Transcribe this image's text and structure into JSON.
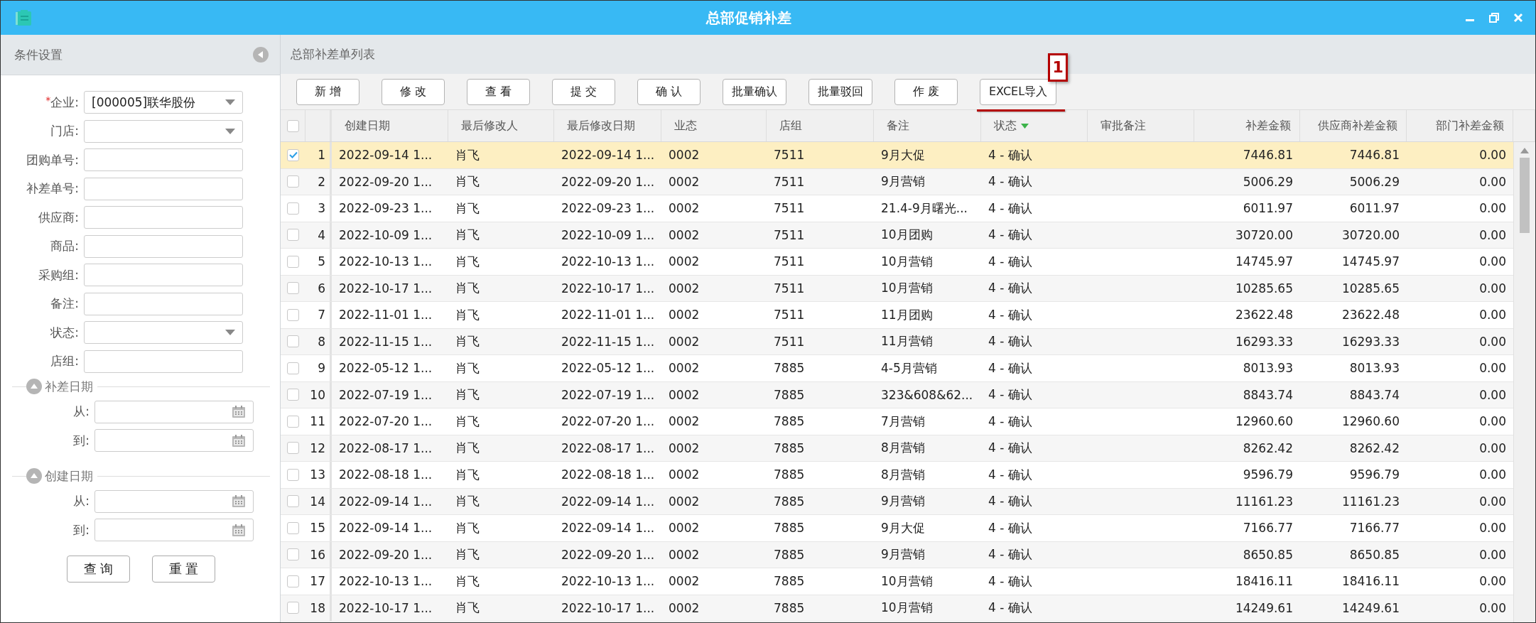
{
  "window": {
    "title": "总部促销补差"
  },
  "filter_panel": {
    "title": "条件设置",
    "fields": [
      {
        "label": "企业:",
        "marker": "*",
        "kind": "select",
        "value": "[000005]联华股份"
      },
      {
        "label": "门店:",
        "kind": "select"
      },
      {
        "label": "团购单号:",
        "kind": "text"
      },
      {
        "label": "补差单号:",
        "kind": "text"
      },
      {
        "label": "供应商:",
        "kind": "text"
      },
      {
        "label": "商品:",
        "kind": "text"
      },
      {
        "label": "采购组:",
        "kind": "text"
      },
      {
        "label": "备注:",
        "kind": "text"
      },
      {
        "label": "状态:",
        "kind": "select"
      },
      {
        "label": "店组:",
        "kind": "text"
      }
    ],
    "sections": [
      {
        "title": "补差日期",
        "expanded": true,
        "fields": [
          {
            "label": "从:"
          },
          {
            "label": "到:"
          }
        ]
      },
      {
        "title": "创建日期",
        "expanded": true,
        "fields": [
          {
            "label": "从:"
          },
          {
            "label": "到:"
          }
        ]
      }
    ],
    "buttons": [
      "查 询",
      "重 置"
    ]
  },
  "list_panel": {
    "title": "总部补差单列表",
    "toolbar": [
      {
        "label": "新 增"
      },
      {
        "label": "修 改"
      },
      {
        "label": "查 看"
      },
      {
        "label": "提 交"
      },
      {
        "label": "确 认"
      },
      {
        "label": "批量确认"
      },
      {
        "label": "批量驳回"
      },
      {
        "label": "作 废"
      },
      {
        "label": "EXCEL导入",
        "callout": "1"
      }
    ],
    "table": {
      "select_all": false,
      "columns": [
        {
          "label": "创建日期"
        },
        {
          "label": "最后修改人"
        },
        {
          "label": "最后修改日期"
        },
        {
          "label": "业态"
        },
        {
          "label": "店组"
        },
        {
          "label": "备注"
        },
        {
          "label": "状态",
          "sorted": true
        },
        {
          "label": "审批备注"
        },
        {
          "label": "补差金额",
          "numeric": true
        },
        {
          "label": "供应商补差金额",
          "numeric": true
        },
        {
          "label": "部门补差金额",
          "numeric": true
        }
      ],
      "rows": [
        {
          "no": "1",
          "selected": true,
          "cells": [
            "2022-09-14 1...",
            "肖飞",
            "2022-09-14 1...",
            "0002",
            "7511",
            "9月大促",
            "4 - 确认",
            "",
            "7446.81",
            "7446.81",
            "0.00"
          ]
        },
        {
          "no": "2",
          "selected": false,
          "cells": [
            "2022-09-20 1...",
            "肖飞",
            "2022-09-20 1...",
            "0002",
            "7511",
            "9月营销",
            "4 - 确认",
            "",
            "5006.29",
            "5006.29",
            "0.00"
          ]
        },
        {
          "no": "3",
          "selected": false,
          "cells": [
            "2022-09-23 1...",
            "肖飞",
            "2022-09-23 1...",
            "0002",
            "7511",
            "21.4-9月曙光...",
            "4 - 确认",
            "",
            "6011.97",
            "6011.97",
            "0.00"
          ]
        },
        {
          "no": "4",
          "selected": false,
          "cells": [
            "2022-10-09 1...",
            "肖飞",
            "2022-10-09 1...",
            "0002",
            "7511",
            "10月团购",
            "4 - 确认",
            "",
            "30720.00",
            "30720.00",
            "0.00"
          ]
        },
        {
          "no": "5",
          "selected": false,
          "cells": [
            "2022-10-13 1...",
            "肖飞",
            "2022-10-13 1...",
            "0002",
            "7511",
            "10月营销",
            "4 - 确认",
            "",
            "14745.97",
            "14745.97",
            "0.00"
          ]
        },
        {
          "no": "6",
          "selected": false,
          "cells": [
            "2022-10-17 1...",
            "肖飞",
            "2022-10-17 1...",
            "0002",
            "7511",
            "10月营销",
            "4 - 确认",
            "",
            "10285.65",
            "10285.65",
            "0.00"
          ]
        },
        {
          "no": "7",
          "selected": false,
          "cells": [
            "2022-11-01 1...",
            "肖飞",
            "2022-11-01 1...",
            "0002",
            "7511",
            "11月团购",
            "4 - 确认",
            "",
            "23622.48",
            "23622.48",
            "0.00"
          ]
        },
        {
          "no": "8",
          "selected": false,
          "cells": [
            "2022-11-15 1...",
            "肖飞",
            "2022-11-15 1...",
            "0002",
            "7511",
            "11月营销",
            "4 - 确认",
            "",
            "16293.33",
            "16293.33",
            "0.00"
          ]
        },
        {
          "no": "9",
          "selected": false,
          "cells": [
            "2022-05-12 1...",
            "肖飞",
            "2022-05-12 1...",
            "0002",
            "7885",
            "4-5月营销",
            "4 - 确认",
            "",
            "8013.93",
            "8013.93",
            "0.00"
          ]
        },
        {
          "no": "10",
          "selected": false,
          "cells": [
            "2022-07-19 1...",
            "肖飞",
            "2022-07-19 1...",
            "0002",
            "7885",
            "323&608&62...",
            "4 - 确认",
            "",
            "8843.74",
            "8843.74",
            "0.00"
          ]
        },
        {
          "no": "11",
          "selected": false,
          "cells": [
            "2022-07-20 1...",
            "肖飞",
            "2022-07-20 1...",
            "0002",
            "7885",
            "7月营销",
            "4 - 确认",
            "",
            "12960.60",
            "12960.60",
            "0.00"
          ]
        },
        {
          "no": "12",
          "selected": false,
          "cells": [
            "2022-08-17 1...",
            "肖飞",
            "2022-08-17 1...",
            "0002",
            "7885",
            "8月营销",
            "4 - 确认",
            "",
            "8262.42",
            "8262.42",
            "0.00"
          ]
        },
        {
          "no": "13",
          "selected": false,
          "cells": [
            "2022-08-18 1...",
            "肖飞",
            "2022-08-18 1...",
            "0002",
            "7885",
            "8月营销",
            "4 - 确认",
            "",
            "9596.79",
            "9596.79",
            "0.00"
          ]
        },
        {
          "no": "14",
          "selected": false,
          "cells": [
            "2022-09-14 1...",
            "肖飞",
            "2022-09-14 1...",
            "0002",
            "7885",
            "9月营销",
            "4 - 确认",
            "",
            "11161.23",
            "11161.23",
            "0.00"
          ]
        },
        {
          "no": "15",
          "selected": false,
          "cells": [
            "2022-09-14 1...",
            "肖飞",
            "2022-09-14 1...",
            "0002",
            "7885",
            "9月大促",
            "4 - 确认",
            "",
            "7166.77",
            "7166.77",
            "0.00"
          ]
        },
        {
          "no": "16",
          "selected": false,
          "cells": [
            "2022-09-20 1...",
            "肖飞",
            "2022-09-20 1...",
            "0002",
            "7885",
            "9月营销",
            "4 - 确认",
            "",
            "8650.85",
            "8650.85",
            "0.00"
          ]
        },
        {
          "no": "17",
          "selected": false,
          "cells": [
            "2022-10-13 1...",
            "肖飞",
            "2022-10-13 1...",
            "0002",
            "7885",
            "10月营销",
            "4 - 确认",
            "",
            "18416.11",
            "18416.11",
            "0.00"
          ]
        },
        {
          "no": "18",
          "selected": false,
          "cells": [
            "2022-10-17 1...",
            "肖飞",
            "2022-10-17 1...",
            "0002",
            "7885",
            "10月营销",
            "4 - 确认",
            "",
            "14249.61",
            "14249.61",
            "0.00"
          ]
        }
      ]
    }
  }
}
